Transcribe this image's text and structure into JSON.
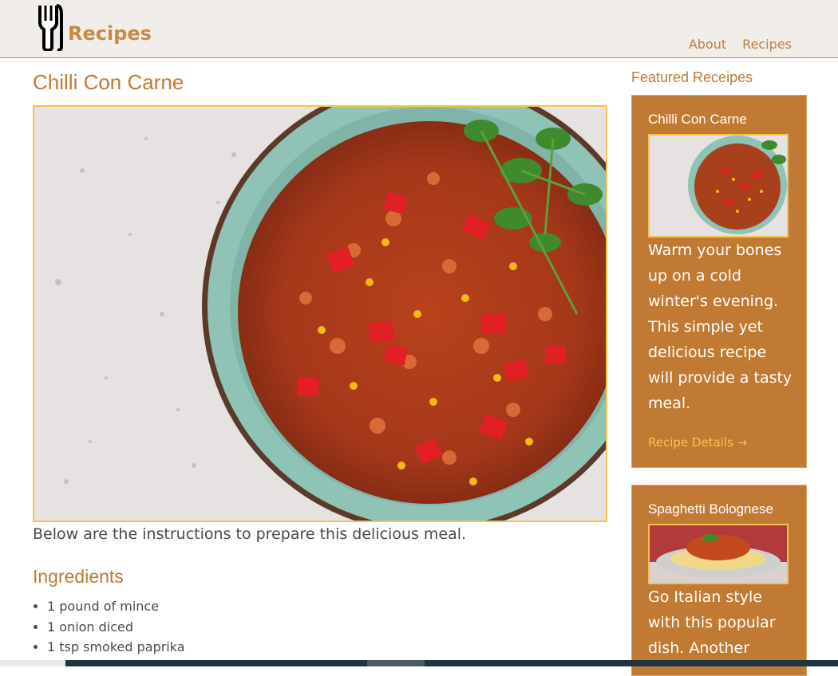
{
  "header": {
    "brand": "Recipes",
    "nav": [
      {
        "label": "About"
      },
      {
        "label": "Recipes"
      }
    ]
  },
  "main": {
    "title": "Chilli Con Carne",
    "intro": "Below are the instructions to prepare this delicious meal.",
    "ingredients_heading": "Ingredients",
    "ingredients": [
      "1 pound of mince",
      "1 onion diced",
      "1 tsp smoked paprika"
    ]
  },
  "sidebar": {
    "title": "Featured Receipes",
    "cards": [
      {
        "title": "Chilli Con Carne",
        "description": "Warm your bones up on a cold winter's evening. This simple yet delicious recipe will provide a tasty meal.",
        "link": "Recipe Details →"
      },
      {
        "title": "Spaghetti Bolognese",
        "description": "Go Italian style with this popular dish. Another"
      }
    ]
  },
  "colors": {
    "accent": "#c17a33",
    "heading": "#bf7a36",
    "image_border": "#f3c44f",
    "header_bg": "#f1ede8"
  }
}
